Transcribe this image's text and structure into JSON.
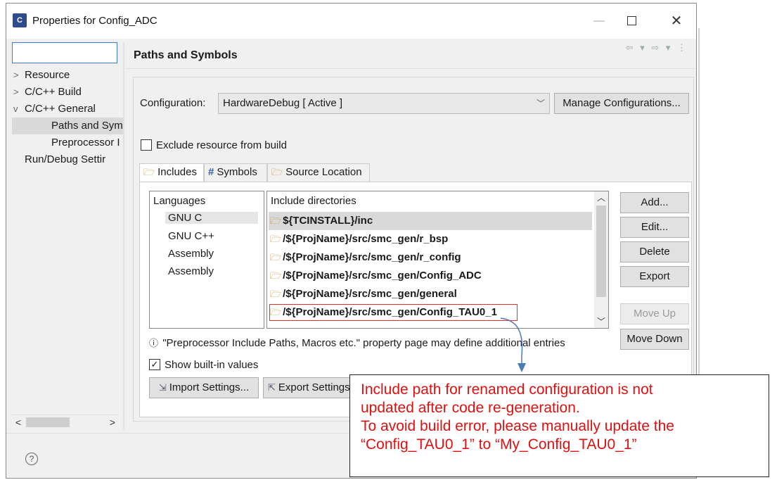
{
  "window": {
    "title": "Properties for Config_ADC",
    "app_icon_text": "C"
  },
  "tree": {
    "filter_value": "",
    "items": [
      {
        "label": "Resource",
        "expander": ">"
      },
      {
        "label": "C/C++ Build",
        "expander": ">"
      },
      {
        "label": "C/C++ General",
        "expander": "v"
      },
      {
        "label": "Paths and Sym",
        "expander": ""
      },
      {
        "label": "Preprocessor I",
        "expander": ""
      },
      {
        "label": "Run/Debug Settir",
        "expander": ""
      }
    ]
  },
  "page": {
    "title": "Paths and Symbols",
    "configuration_label": "Configuration:",
    "configuration_value": "HardwareDebug  [ Active ]",
    "manage_button": "Manage Configurations...",
    "exclude_label": "Exclude resource from build",
    "exclude_checked": false,
    "tabs": [
      {
        "label": "Includes",
        "icon": "includes-icon"
      },
      {
        "label": "Symbols",
        "icon": "hash-icon"
      },
      {
        "label": "Source Location",
        "icon": "folder-icon"
      }
    ],
    "languages_header": "Languages",
    "languages": [
      "GNU C",
      "GNU C++",
      "Assembly",
      "Assembly"
    ],
    "include_header": "Include directories",
    "include_dirs": [
      "${TCINSTALL}/inc",
      "/${ProjName}/src/smc_gen/r_bsp",
      "/${ProjName}/src/smc_gen/r_config",
      "/${ProjName}/src/smc_gen/Config_ADC",
      "/${ProjName}/src/smc_gen/general",
      "/${ProjName}/src/smc_gen/Config_TAU0_1"
    ],
    "buttons": {
      "add": "Add...",
      "edit": "Edit...",
      "delete": "Delete",
      "export": "Export",
      "move_up": "Move Up",
      "move_down": "Move Down"
    },
    "info_text": "\"Preprocessor Include Paths, Macros etc.\" property page may define additional entries",
    "info_icon": "ⓘ",
    "show_builtin_label": "Show built-in values",
    "show_builtin_checked": true,
    "import_button": "Import Settings...",
    "export_button": "Export Settings"
  },
  "callout": {
    "lines": [
      "Include path for renamed configuration is not",
      "updated after code re-generation.",
      "To avoid build error, please manually update the",
      "“Config_TAU0_1” to “My_Config_TAU0_1”"
    ],
    "color": "#e01010"
  },
  "colors": {
    "accent_border": "#3a7bd5",
    "highlight": "#e03030",
    "arrow": "#4a7ab8"
  }
}
